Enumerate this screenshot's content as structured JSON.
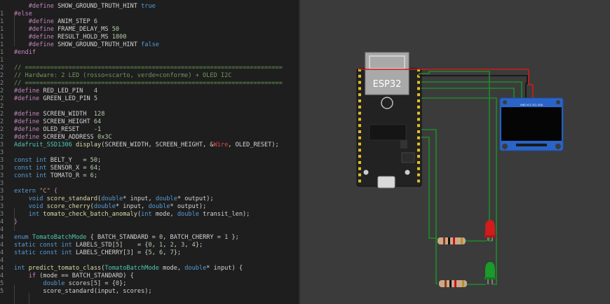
{
  "editor": {
    "lines": [
      {
        "n": "",
        "tokens": [
          {
            "t": "    #define ",
            "c": "pp"
          },
          {
            "t": "SHOW_GROUND_TRUTH_HINT ",
            "c": "id"
          },
          {
            "t": "true",
            "c": "kw"
          }
        ]
      },
      {
        "n": "1",
        "tokens": [
          {
            "t": "#else",
            "c": "pp"
          }
        ]
      },
      {
        "n": "1",
        "tokens": [
          {
            "t": "    #define ",
            "c": "pp"
          },
          {
            "t": "ANIM_STEP ",
            "c": "id"
          },
          {
            "t": "6",
            "c": "num"
          }
        ]
      },
      {
        "n": "1",
        "tokens": [
          {
            "t": "    #define ",
            "c": "pp"
          },
          {
            "t": "FRAME_DELAY_MS ",
            "c": "id"
          },
          {
            "t": "50",
            "c": "num"
          }
        ]
      },
      {
        "n": "1",
        "tokens": [
          {
            "t": "    #define ",
            "c": "pp"
          },
          {
            "t": "RESULT_HOLD_MS ",
            "c": "id"
          },
          {
            "t": "1800",
            "c": "num"
          }
        ]
      },
      {
        "n": "1",
        "tokens": [
          {
            "t": "    #define ",
            "c": "pp"
          },
          {
            "t": "SHOW_GROUND_TRUTH_HINT ",
            "c": "id"
          },
          {
            "t": "false",
            "c": "kw"
          }
        ]
      },
      {
        "n": "1",
        "tokens": [
          {
            "t": "#endif",
            "c": "pp"
          }
        ]
      },
      {
        "n": "1",
        "tokens": []
      },
      {
        "n": "2",
        "tokens": [
          {
            "t": "// =======================================================================",
            "c": "cm"
          }
        ]
      },
      {
        "n": "2",
        "tokens": [
          {
            "t": "// Hardware: 2 LED (rosso=scarto, verde=conforme) + OLED I2C",
            "c": "cm"
          }
        ]
      },
      {
        "n": "2",
        "tokens": [
          {
            "t": "// =======================================================================",
            "c": "cm"
          }
        ]
      },
      {
        "n": "2",
        "tokens": [
          {
            "t": "#define ",
            "c": "pp"
          },
          {
            "t": "RED_LED_PIN   ",
            "c": "id"
          },
          {
            "t": "4",
            "c": "num"
          }
        ]
      },
      {
        "n": "2",
        "tokens": [
          {
            "t": "#define ",
            "c": "pp"
          },
          {
            "t": "GREEN_LED_PIN ",
            "c": "id"
          },
          {
            "t": "5",
            "c": "num"
          }
        ]
      },
      {
        "n": "2",
        "tokens": []
      },
      {
        "n": "2",
        "tokens": [
          {
            "t": "#define ",
            "c": "pp"
          },
          {
            "t": "SCREEN_WIDTH  ",
            "c": "id"
          },
          {
            "t": "128",
            "c": "num"
          }
        ]
      },
      {
        "n": "2",
        "tokens": [
          {
            "t": "#define ",
            "c": "pp"
          },
          {
            "t": "SCREEN_HEIGHT ",
            "c": "id"
          },
          {
            "t": "64",
            "c": "num"
          }
        ]
      },
      {
        "n": "2",
        "tokens": [
          {
            "t": "#define ",
            "c": "pp"
          },
          {
            "t": "OLED_RESET    ",
            "c": "id"
          },
          {
            "t": "-1",
            "c": "num"
          }
        ]
      },
      {
        "n": "2",
        "tokens": [
          {
            "t": "#define ",
            "c": "pp"
          },
          {
            "t": "SCREEN_ADDRESS ",
            "c": "id"
          },
          {
            "t": "0x3C",
            "c": "num"
          }
        ]
      },
      {
        "n": "3",
        "tokens": [
          {
            "t": "Adafruit_SSD1306 ",
            "c": "ty"
          },
          {
            "t": "display",
            "c": "fn"
          },
          {
            "t": "(SCREEN_WIDTH, SCREEN_HEIGHT, &",
            "c": "id"
          },
          {
            "t": "Wire",
            "c": "hl"
          },
          {
            "t": ", OLED_RESET);",
            "c": "id"
          }
        ]
      },
      {
        "n": "3",
        "tokens": []
      },
      {
        "n": "3",
        "tokens": [
          {
            "t": "const ",
            "c": "kw"
          },
          {
            "t": "int ",
            "c": "kw"
          },
          {
            "t": "BELT_Y   = ",
            "c": "id"
          },
          {
            "t": "50",
            "c": "num"
          },
          {
            "t": ";",
            "c": "id"
          }
        ]
      },
      {
        "n": "3",
        "tokens": [
          {
            "t": "const ",
            "c": "kw"
          },
          {
            "t": "int ",
            "c": "kw"
          },
          {
            "t": "SENSOR_X = ",
            "c": "id"
          },
          {
            "t": "64",
            "c": "num"
          },
          {
            "t": ";",
            "c": "id"
          }
        ]
      },
      {
        "n": "3",
        "tokens": [
          {
            "t": "const ",
            "c": "kw"
          },
          {
            "t": "int ",
            "c": "kw"
          },
          {
            "t": "TOMATO_R = ",
            "c": "id"
          },
          {
            "t": "6",
            "c": "num"
          },
          {
            "t": ";",
            "c": "id"
          }
        ]
      },
      {
        "n": "3",
        "tokens": []
      },
      {
        "n": "3",
        "tokens": [
          {
            "t": "extern ",
            "c": "kw"
          },
          {
            "t": "\"C\"",
            "c": "str"
          },
          {
            "t": " {",
            "c": "pp"
          }
        ]
      },
      {
        "n": "3",
        "tokens": [
          {
            "t": "    void ",
            "c": "kw"
          },
          {
            "t": "score_standard",
            "c": "fn"
          },
          {
            "t": "(",
            "c": "id"
          },
          {
            "t": "double",
            "c": "kw"
          },
          {
            "t": "* input, ",
            "c": "id"
          },
          {
            "t": "double",
            "c": "kw"
          },
          {
            "t": "* output);",
            "c": "id"
          }
        ]
      },
      {
        "n": "3",
        "tokens": [
          {
            "t": "    void ",
            "c": "kw"
          },
          {
            "t": "score_cherry",
            "c": "fn"
          },
          {
            "t": "(",
            "c": "id"
          },
          {
            "t": "double",
            "c": "kw"
          },
          {
            "t": "* input, ",
            "c": "id"
          },
          {
            "t": "double",
            "c": "kw"
          },
          {
            "t": "* output);",
            "c": "id"
          }
        ]
      },
      {
        "n": "3",
        "tokens": [
          {
            "t": "    int ",
            "c": "kw"
          },
          {
            "t": "tomato_check_batch_anomaly",
            "c": "fn"
          },
          {
            "t": "(",
            "c": "id"
          },
          {
            "t": "int ",
            "c": "kw"
          },
          {
            "t": "mode, ",
            "c": "id"
          },
          {
            "t": "double ",
            "c": "kw"
          },
          {
            "t": "transit_len);",
            "c": "id"
          }
        ]
      },
      {
        "n": "4",
        "tokens": [
          {
            "t": "}",
            "c": "pp"
          }
        ]
      },
      {
        "n": "4",
        "tokens": []
      },
      {
        "n": "4",
        "tokens": [
          {
            "t": "enum ",
            "c": "kw"
          },
          {
            "t": "TomatoBatchMode ",
            "c": "ty"
          },
          {
            "t": "{ BATCH_STANDARD = ",
            "c": "id"
          },
          {
            "t": "0",
            "c": "num"
          },
          {
            "t": ", BATCH_CHERRY = ",
            "c": "id"
          },
          {
            "t": "1",
            "c": "num"
          },
          {
            "t": " };",
            "c": "id"
          }
        ]
      },
      {
        "n": "4",
        "tokens": [
          {
            "t": "static ",
            "c": "kw"
          },
          {
            "t": "const ",
            "c": "kw"
          },
          {
            "t": "int ",
            "c": "kw"
          },
          {
            "t": "LABELS_STD[",
            "c": "id"
          },
          {
            "t": "5",
            "c": "num"
          },
          {
            "t": "]    = {",
            "c": "id"
          },
          {
            "t": "0",
            "c": "num"
          },
          {
            "t": ", ",
            "c": "id"
          },
          {
            "t": "1",
            "c": "num"
          },
          {
            "t": ", ",
            "c": "id"
          },
          {
            "t": "2",
            "c": "num"
          },
          {
            "t": ", ",
            "c": "id"
          },
          {
            "t": "3",
            "c": "num"
          },
          {
            "t": ", ",
            "c": "id"
          },
          {
            "t": "4",
            "c": "num"
          },
          {
            "t": "};",
            "c": "id"
          }
        ]
      },
      {
        "n": "4",
        "tokens": [
          {
            "t": "static ",
            "c": "kw"
          },
          {
            "t": "const ",
            "c": "kw"
          },
          {
            "t": "int ",
            "c": "kw"
          },
          {
            "t": "LABELS_CHERRY[",
            "c": "id"
          },
          {
            "t": "3",
            "c": "num"
          },
          {
            "t": "] = {",
            "c": "id"
          },
          {
            "t": "5",
            "c": "num"
          },
          {
            "t": ", ",
            "c": "id"
          },
          {
            "t": "6",
            "c": "num"
          },
          {
            "t": ", ",
            "c": "id"
          },
          {
            "t": "7",
            "c": "num"
          },
          {
            "t": "};",
            "c": "id"
          }
        ]
      },
      {
        "n": "4",
        "tokens": []
      },
      {
        "n": "4",
        "tokens": [
          {
            "t": "int ",
            "c": "kw"
          },
          {
            "t": "predict_tomato_class",
            "c": "fn"
          },
          {
            "t": "(",
            "c": "id"
          },
          {
            "t": "TomatoBatchMode ",
            "c": "ty"
          },
          {
            "t": "mode, ",
            "c": "id"
          },
          {
            "t": "double",
            "c": "kw"
          },
          {
            "t": "* input) {",
            "c": "id"
          }
        ]
      },
      {
        "n": "4",
        "tokens": [
          {
            "t": "    if ",
            "c": "pp"
          },
          {
            "t": "(mode == BATCH_STANDARD) {",
            "c": "id"
          }
        ]
      },
      {
        "n": "5",
        "tokens": [
          {
            "t": "        double ",
            "c": "kw"
          },
          {
            "t": "scores[",
            "c": "id"
          },
          {
            "t": "5",
            "c": "num"
          },
          {
            "t": "] = {",
            "c": "id"
          },
          {
            "t": "0",
            "c": "num"
          },
          {
            "t": "};",
            "c": "id"
          }
        ]
      },
      {
        "n": "5",
        "tokens": [
          {
            "t": "        score_standard(input, scores);",
            "c": "id"
          }
        ]
      }
    ]
  },
  "simulator": {
    "board_label": "ESP32",
    "oled_pin_labels": "GND VCC SCL SDA",
    "colors": {
      "canvas_bg": "#3b3b3b",
      "board": "#222222",
      "wire_red": "#d11a1a",
      "wire_black": "#111111",
      "wire_green": "#1f8a2a",
      "oled_body": "#2a64c8",
      "oled_screen": "#050505",
      "led_red": "#d01c1c",
      "led_green": "#1c9a2a"
    }
  }
}
